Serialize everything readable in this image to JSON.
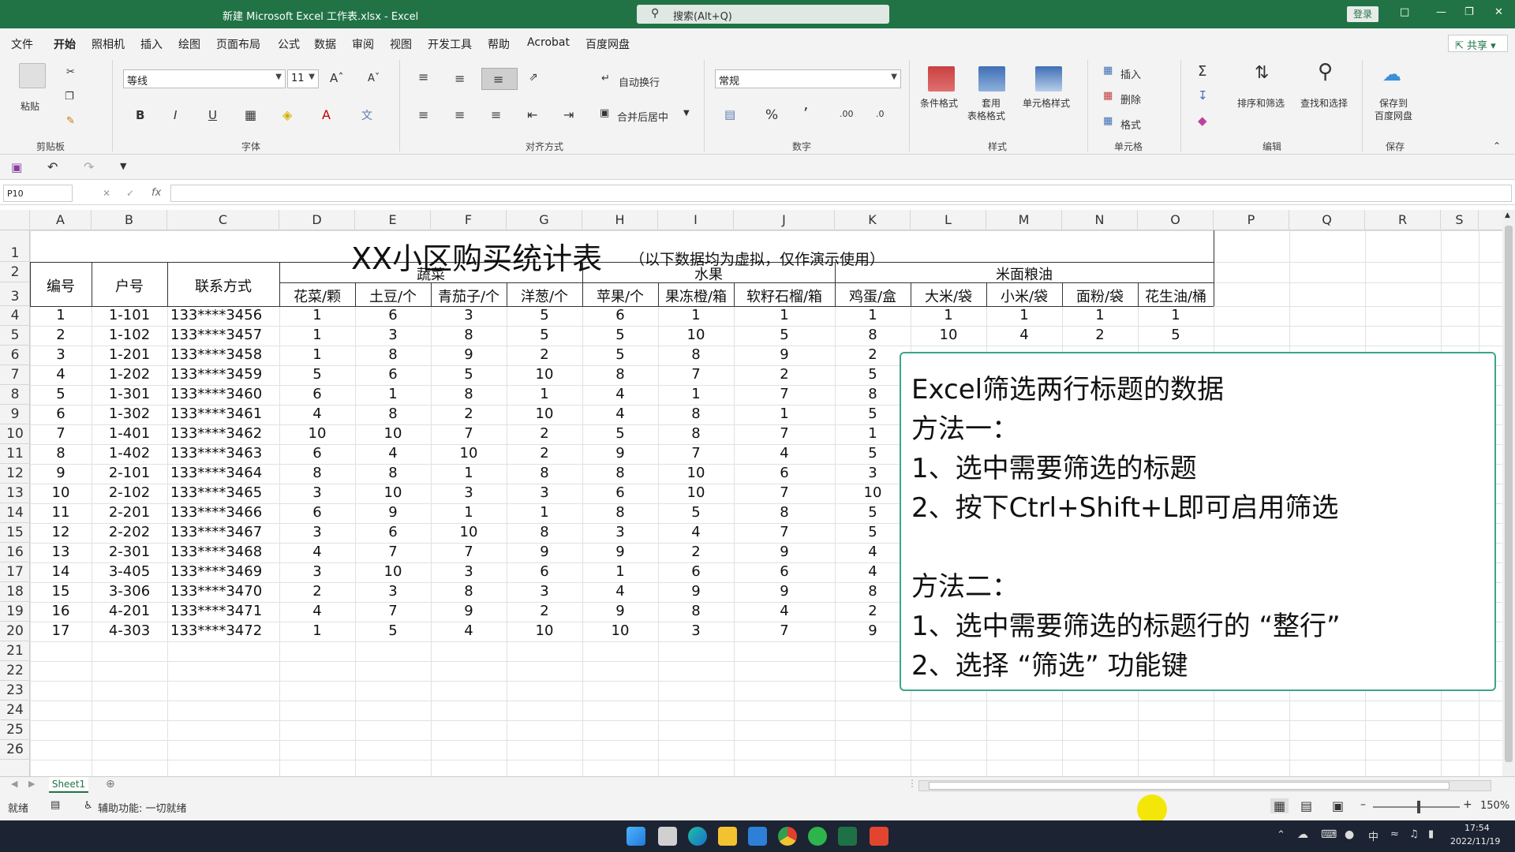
{
  "window": {
    "title": "新建 Microsoft Excel 工作表.xlsx  -  Excel",
    "search_placeholder": "搜索(Alt+Q)",
    "login": "登录"
  },
  "menu": {
    "items": [
      "文件",
      "开始",
      "照相机",
      "插入",
      "绘图",
      "页面布局",
      "公式",
      "数据",
      "审阅",
      "视图",
      "开发工具",
      "帮助",
      "Acrobat",
      "百度网盘"
    ],
    "active": "开始",
    "share": "共享"
  },
  "ribbon": {
    "clipboard": {
      "paste": "粘贴",
      "label": "剪贴板"
    },
    "font": {
      "name": "等线",
      "size": "11",
      "label": "字体",
      "bold": "B",
      "italic": "I",
      "underline": "U"
    },
    "alignment": {
      "wrap": "自动换行",
      "merge": "合并后居中",
      "label": "对齐方式"
    },
    "number": {
      "format": "常规",
      "label": "数字"
    },
    "styles": {
      "conditional": "条件格式",
      "table1": "套用",
      "table2": "表格格式",
      "cell_styles": "单元格样式",
      "label": "样式"
    },
    "cells": {
      "insert": "插入",
      "delete": "删除",
      "format": "格式",
      "label": "单元格"
    },
    "editing": {
      "sort": "排序和筛选",
      "find": "查找和选择",
      "label": "编辑"
    },
    "save": {
      "save1": "保存到",
      "save2": "百度网盘",
      "label": "保存"
    }
  },
  "formula_bar": {
    "namebox": "P10",
    "fx": "fx"
  },
  "sheet": {
    "columns": [
      "A",
      "B",
      "C",
      "D",
      "E",
      "F",
      "G",
      "H",
      "I",
      "J",
      "K",
      "L",
      "M",
      "N",
      "O",
      "P",
      "Q",
      "R",
      "S"
    ],
    "rows": [
      "1",
      "2",
      "3",
      "4",
      "5",
      "6",
      "7",
      "8",
      "9",
      "10",
      "11",
      "12",
      "13",
      "14",
      "15",
      "16",
      "17",
      "18",
      "19",
      "20",
      "21",
      "22",
      "23",
      "24",
      "25",
      "26"
    ],
    "title": "XX小区购买统计表",
    "subtitle": "（以下数据均为虚拟，仅作演示使用）",
    "header_group": {
      "id": "编号",
      "unit": "户号",
      "contact": "联系方式",
      "veg": "蔬菜",
      "fruit": "水果",
      "grain": "米面粮油"
    },
    "header_items": [
      "花菜/颗",
      "土豆/个",
      "青茄子/个",
      "洋葱/个",
      "苹果/个",
      "果冻橙/箱",
      "软籽石榴/箱",
      "鸡蛋/盒",
      "大米/袋",
      "小米/袋",
      "面粉/袋",
      "花生油/桶"
    ],
    "data": [
      [
        "1",
        "1-101",
        "133****3456",
        "1",
        "6",
        "3",
        "5",
        "6",
        "1",
        "1",
        "1",
        "1",
        "1",
        "1",
        "1"
      ],
      [
        "2",
        "1-102",
        "133****3457",
        "1",
        "3",
        "8",
        "5",
        "5",
        "10",
        "5",
        "8",
        "10",
        "4",
        "2",
        "5"
      ],
      [
        "3",
        "1-201",
        "133****3458",
        "1",
        "8",
        "9",
        "2",
        "5",
        "8",
        "9",
        "2"
      ],
      [
        "4",
        "1-202",
        "133****3459",
        "5",
        "6",
        "5",
        "10",
        "8",
        "7",
        "2",
        "5"
      ],
      [
        "5",
        "1-301",
        "133****3460",
        "6",
        "1",
        "8",
        "1",
        "4",
        "1",
        "7",
        "8"
      ],
      [
        "6",
        "1-302",
        "133****3461",
        "4",
        "8",
        "2",
        "10",
        "4",
        "8",
        "1",
        "5"
      ],
      [
        "7",
        "1-401",
        "133****3462",
        "10",
        "10",
        "7",
        "2",
        "5",
        "8",
        "7",
        "1"
      ],
      [
        "8",
        "1-402",
        "133****3463",
        "6",
        "4",
        "10",
        "2",
        "9",
        "7",
        "4",
        "5"
      ],
      [
        "9",
        "2-101",
        "133****3464",
        "8",
        "8",
        "1",
        "8",
        "8",
        "10",
        "6",
        "3"
      ],
      [
        "10",
        "2-102",
        "133****3465",
        "3",
        "10",
        "3",
        "3",
        "6",
        "10",
        "7",
        "10"
      ],
      [
        "11",
        "2-201",
        "133****3466",
        "6",
        "9",
        "1",
        "1",
        "8",
        "5",
        "8",
        "5"
      ],
      [
        "12",
        "2-202",
        "133****3467",
        "3",
        "6",
        "10",
        "8",
        "3",
        "4",
        "7",
        "5"
      ],
      [
        "13",
        "2-301",
        "133****3468",
        "4",
        "7",
        "7",
        "9",
        "9",
        "2",
        "9",
        "4"
      ],
      [
        "14",
        "3-405",
        "133****3469",
        "3",
        "10",
        "3",
        "6",
        "1",
        "6",
        "6",
        "4"
      ],
      [
        "15",
        "3-306",
        "133****3470",
        "2",
        "3",
        "8",
        "3",
        "4",
        "9",
        "9",
        "8"
      ],
      [
        "16",
        "4-201",
        "133****3471",
        "4",
        "7",
        "9",
        "2",
        "9",
        "8",
        "4",
        "2"
      ],
      [
        "17",
        "4-303",
        "133****3472",
        "1",
        "5",
        "4",
        "10",
        "10",
        "3",
        "7",
        "9"
      ]
    ]
  },
  "note": {
    "lines": [
      "Excel筛选两行标题的数据",
      "方法一：",
      "1、选中需要筛选的标题",
      "2、按下Ctrl+Shift+L即可启用筛选",
      "",
      "方法二：",
      "1、选中需要筛选的标题行的 “整行”",
      "2、选择 “筛选” 功能键"
    ]
  },
  "tabs": {
    "sheet1": "Sheet1"
  },
  "status": {
    "ready": "就绪",
    "accessibility": "辅助功能: 一切就绪",
    "zoom": "150%"
  },
  "taskbar": {
    "time": "17:54",
    "date": "2022/11/19",
    "ime": "中"
  },
  "colors": {
    "accent": "#217346",
    "note_border": "#3aa58a",
    "cursor": "#f5e60a"
  }
}
